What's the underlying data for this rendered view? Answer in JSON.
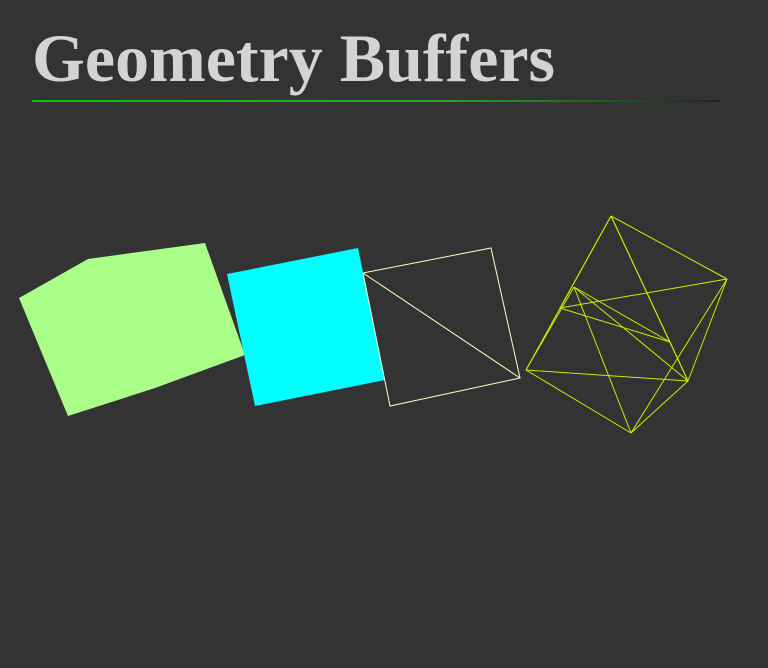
{
  "page": {
    "title": "Geometry Buffers"
  },
  "theme": {
    "background": "#333333",
    "title_color": "#d3d3d3",
    "rule_color": "#00cc00"
  },
  "scene": {
    "shapes": [
      {
        "name": "filled-pentagon",
        "style": "filled",
        "color": "#aaff88"
      },
      {
        "name": "filled-square",
        "style": "filled",
        "color": "#00ffff"
      },
      {
        "name": "wireframe-square",
        "style": "wireframe",
        "color": "#ffffcc"
      },
      {
        "name": "wireframe-octahedron",
        "style": "wireframe",
        "color": "#ccee00"
      }
    ]
  }
}
